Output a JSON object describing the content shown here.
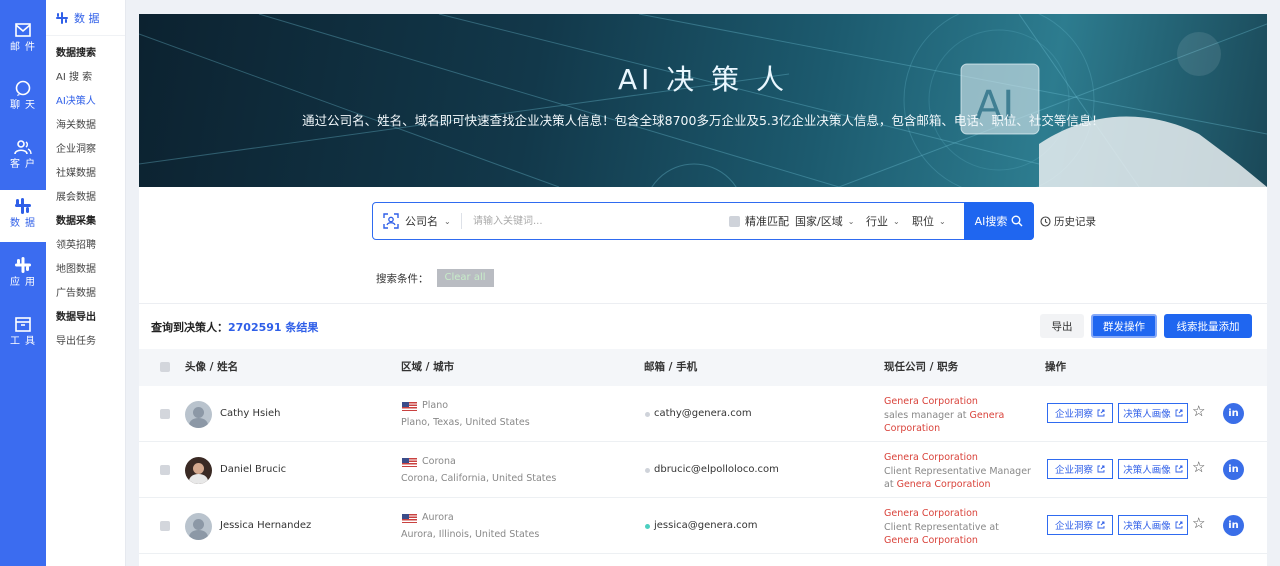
{
  "rail": [
    {
      "label": "邮件",
      "icon": "mail-icon"
    },
    {
      "label": "聊天",
      "icon": "chat-icon"
    },
    {
      "label": "客户",
      "icon": "customers-icon"
    },
    {
      "label": "数据",
      "icon": "data-icon"
    },
    {
      "label": "应用",
      "icon": "apps-icon"
    },
    {
      "label": "工具",
      "icon": "toolbox-icon"
    }
  ],
  "subnav": {
    "header": "数 据",
    "sections": [
      {
        "title": "数据搜索",
        "items": [
          "AI 搜 索",
          "AI决策人",
          "海关数据",
          "企业洞察",
          "社媒数据",
          "展会数据"
        ]
      },
      {
        "title": "数据采集",
        "items": [
          "领英招聘",
          "地图数据",
          "广告数据"
        ]
      },
      {
        "title": "数据导出",
        "items": [
          "导出任务"
        ]
      }
    ]
  },
  "banner": {
    "title": "AI 决 策 人",
    "subtitle": "通过公司名、姓名、域名即可快速查找企业决策人信息！包含全球8700多万企业及5.3亿企业决策人信息，包含邮箱、电话、职位、社交等信息！"
  },
  "search": {
    "scope": "公司名",
    "placeholder": "请输入关键词...",
    "exact_match": "精准匹配",
    "filters": [
      "国家/区域",
      "行业",
      "职位"
    ],
    "button": "AI搜索",
    "history": "历史记录"
  },
  "conditions": {
    "label": "搜索条件：",
    "clear": "Clear all"
  },
  "results": {
    "count_label": "查询到决策人：",
    "count_value": "2702591 条结果",
    "export": "导出",
    "group_action": "群发操作",
    "batch_add": "线索批量添加"
  },
  "table": {
    "headers": [
      "头像 / 姓名",
      "区域 / 城市",
      "邮箱 / 手机",
      "现任公司 / 职务",
      "操作"
    ],
    "rows": [
      {
        "name": "Cathy Hsieh",
        "city": "Plano",
        "region": "Plano, Texas, United States",
        "email": "cathy@genera.com",
        "company": "Genera Corporation",
        "title_prefix": "sales manager at",
        "title_company": "Genera Corporation"
      },
      {
        "name": "Daniel Brucic",
        "city": "Corona",
        "region": "Corona, California, United States",
        "email": "dbrucic@elpolloloco.com",
        "company": "Genera Corporation",
        "title_prefix": "Client Representative Manager at",
        "title_company": "Genera Corporation"
      },
      {
        "name": "Jessica Hernandez",
        "city": "Aurora",
        "region": "Aurora, Illinois, United States",
        "email": "jessica@genera.com",
        "company": "Genera Corporation",
        "title_prefix": "Client Representative at",
        "title_company": "Genera Corporation"
      }
    ],
    "action_insight": "企业洞察",
    "action_profile": "决策人画像",
    "linkedin": "in"
  }
}
